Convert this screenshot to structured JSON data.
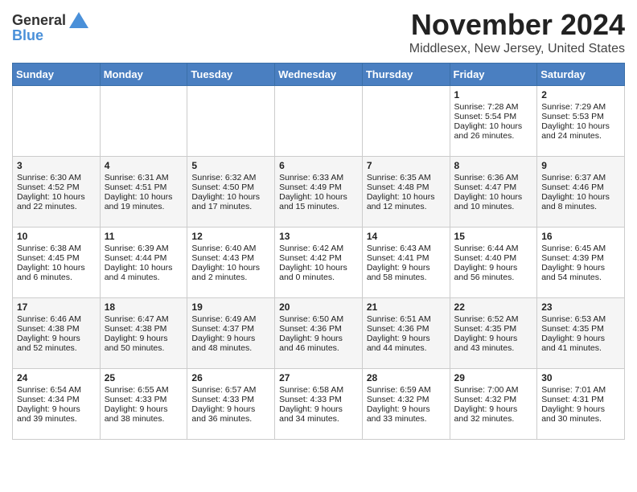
{
  "header": {
    "logo_general": "General",
    "logo_blue": "Blue",
    "month_title": "November 2024",
    "location": "Middlesex, New Jersey, United States"
  },
  "days_of_week": [
    "Sunday",
    "Monday",
    "Tuesday",
    "Wednesday",
    "Thursday",
    "Friday",
    "Saturday"
  ],
  "weeks": [
    {
      "cells": [
        {
          "day": "",
          "content": ""
        },
        {
          "day": "",
          "content": ""
        },
        {
          "day": "",
          "content": ""
        },
        {
          "day": "",
          "content": ""
        },
        {
          "day": "",
          "content": ""
        },
        {
          "day": "1",
          "content": "Sunrise: 7:28 AM\nSunset: 5:54 PM\nDaylight: 10 hours and 26 minutes."
        },
        {
          "day": "2",
          "content": "Sunrise: 7:29 AM\nSunset: 5:53 PM\nDaylight: 10 hours and 24 minutes."
        }
      ]
    },
    {
      "cells": [
        {
          "day": "3",
          "content": "Sunrise: 6:30 AM\nSunset: 4:52 PM\nDaylight: 10 hours and 22 minutes."
        },
        {
          "day": "4",
          "content": "Sunrise: 6:31 AM\nSunset: 4:51 PM\nDaylight: 10 hours and 19 minutes."
        },
        {
          "day": "5",
          "content": "Sunrise: 6:32 AM\nSunset: 4:50 PM\nDaylight: 10 hours and 17 minutes."
        },
        {
          "day": "6",
          "content": "Sunrise: 6:33 AM\nSunset: 4:49 PM\nDaylight: 10 hours and 15 minutes."
        },
        {
          "day": "7",
          "content": "Sunrise: 6:35 AM\nSunset: 4:48 PM\nDaylight: 10 hours and 12 minutes."
        },
        {
          "day": "8",
          "content": "Sunrise: 6:36 AM\nSunset: 4:47 PM\nDaylight: 10 hours and 10 minutes."
        },
        {
          "day": "9",
          "content": "Sunrise: 6:37 AM\nSunset: 4:46 PM\nDaylight: 10 hours and 8 minutes."
        }
      ]
    },
    {
      "cells": [
        {
          "day": "10",
          "content": "Sunrise: 6:38 AM\nSunset: 4:45 PM\nDaylight: 10 hours and 6 minutes."
        },
        {
          "day": "11",
          "content": "Sunrise: 6:39 AM\nSunset: 4:44 PM\nDaylight: 10 hours and 4 minutes."
        },
        {
          "day": "12",
          "content": "Sunrise: 6:40 AM\nSunset: 4:43 PM\nDaylight: 10 hours and 2 minutes."
        },
        {
          "day": "13",
          "content": "Sunrise: 6:42 AM\nSunset: 4:42 PM\nDaylight: 10 hours and 0 minutes."
        },
        {
          "day": "14",
          "content": "Sunrise: 6:43 AM\nSunset: 4:41 PM\nDaylight: 9 hours and 58 minutes."
        },
        {
          "day": "15",
          "content": "Sunrise: 6:44 AM\nSunset: 4:40 PM\nDaylight: 9 hours and 56 minutes."
        },
        {
          "day": "16",
          "content": "Sunrise: 6:45 AM\nSunset: 4:39 PM\nDaylight: 9 hours and 54 minutes."
        }
      ]
    },
    {
      "cells": [
        {
          "day": "17",
          "content": "Sunrise: 6:46 AM\nSunset: 4:38 PM\nDaylight: 9 hours and 52 minutes."
        },
        {
          "day": "18",
          "content": "Sunrise: 6:47 AM\nSunset: 4:38 PM\nDaylight: 9 hours and 50 minutes."
        },
        {
          "day": "19",
          "content": "Sunrise: 6:49 AM\nSunset: 4:37 PM\nDaylight: 9 hours and 48 minutes."
        },
        {
          "day": "20",
          "content": "Sunrise: 6:50 AM\nSunset: 4:36 PM\nDaylight: 9 hours and 46 minutes."
        },
        {
          "day": "21",
          "content": "Sunrise: 6:51 AM\nSunset: 4:36 PM\nDaylight: 9 hours and 44 minutes."
        },
        {
          "day": "22",
          "content": "Sunrise: 6:52 AM\nSunset: 4:35 PM\nDaylight: 9 hours and 43 minutes."
        },
        {
          "day": "23",
          "content": "Sunrise: 6:53 AM\nSunset: 4:35 PM\nDaylight: 9 hours and 41 minutes."
        }
      ]
    },
    {
      "cells": [
        {
          "day": "24",
          "content": "Sunrise: 6:54 AM\nSunset: 4:34 PM\nDaylight: 9 hours and 39 minutes."
        },
        {
          "day": "25",
          "content": "Sunrise: 6:55 AM\nSunset: 4:33 PM\nDaylight: 9 hours and 38 minutes."
        },
        {
          "day": "26",
          "content": "Sunrise: 6:57 AM\nSunset: 4:33 PM\nDaylight: 9 hours and 36 minutes."
        },
        {
          "day": "27",
          "content": "Sunrise: 6:58 AM\nSunset: 4:33 PM\nDaylight: 9 hours and 34 minutes."
        },
        {
          "day": "28",
          "content": "Sunrise: 6:59 AM\nSunset: 4:32 PM\nDaylight: 9 hours and 33 minutes."
        },
        {
          "day": "29",
          "content": "Sunrise: 7:00 AM\nSunset: 4:32 PM\nDaylight: 9 hours and 32 minutes."
        },
        {
          "day": "30",
          "content": "Sunrise: 7:01 AM\nSunset: 4:31 PM\nDaylight: 9 hours and 30 minutes."
        }
      ]
    }
  ]
}
